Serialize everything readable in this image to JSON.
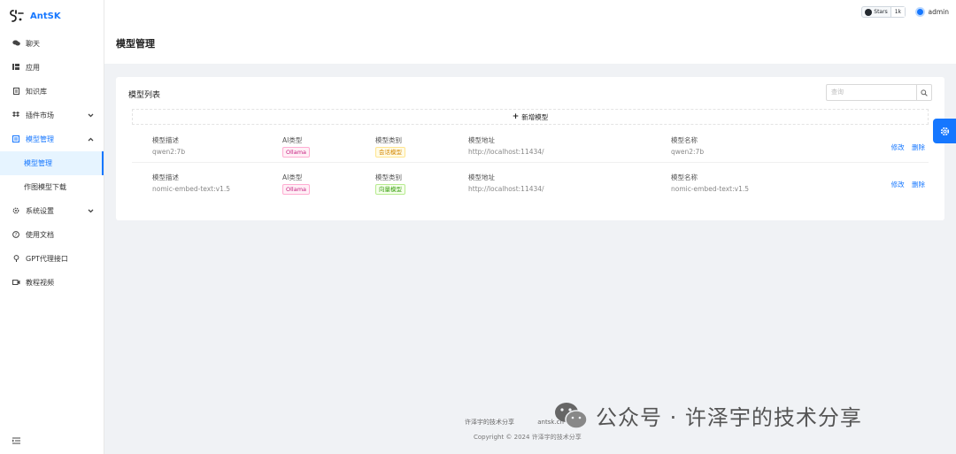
{
  "app": {
    "name": "AntSK",
    "logo_mark": "ℌ"
  },
  "sidebar": {
    "items": [
      {
        "label": "聊天",
        "icon": "chat-icon"
      },
      {
        "label": "应用",
        "icon": "app-icon"
      },
      {
        "label": "知识库",
        "icon": "book-icon"
      },
      {
        "label": "插件市场",
        "icon": "dropbox-icon"
      },
      {
        "label": "模型管理",
        "icon": "model-icon"
      },
      {
        "label": "系统设置",
        "icon": "gear-icon"
      },
      {
        "label": "使用文档",
        "icon": "question-icon"
      },
      {
        "label": "GPT代理接口",
        "icon": "bulb-icon"
      },
      {
        "label": "教程视频",
        "icon": "video-icon"
      }
    ],
    "sub_items": [
      {
        "label": "模型管理"
      },
      {
        "label": "作图模型下载"
      }
    ]
  },
  "topbar": {
    "github_label": "Stars",
    "github_count": "1k",
    "username": "admin"
  },
  "page": {
    "title": "模型管理"
  },
  "card": {
    "title": "模型列表",
    "search_placeholder": "查询",
    "add_label": "新增模型",
    "columns": {
      "desc": "模型描述",
      "ai_type": "AI类型",
      "category": "模型类别",
      "url": "模型地址",
      "name": "模型名称"
    },
    "rows": [
      {
        "desc": "qwen2:7b",
        "ai_type": "Ollama",
        "category": "会话模型",
        "url": "http://localhost:11434/",
        "name": "qwen2:7b",
        "edit": "修改",
        "delete": "删除"
      },
      {
        "desc": "nomic-embed-text:v1.5",
        "ai_type": "Ollama",
        "category": "向量模型",
        "url": "http://localhost:11434/",
        "name": "nomic-embed-text:v1.5",
        "edit": "修改",
        "delete": "删除"
      }
    ]
  },
  "footer": {
    "link1": "许泽宇的技术分享",
    "link2": "antsk.cn",
    "copyright": "Copyright © 2024 许泽宇的技术分享"
  },
  "watermark": {
    "text": "公众号 · 许泽宇的技术分享"
  },
  "colors": {
    "accent": "#1677ff",
    "tag_pink": "#c41d7f",
    "tag_gold": "#d48806",
    "tag_green": "#389e0d"
  }
}
